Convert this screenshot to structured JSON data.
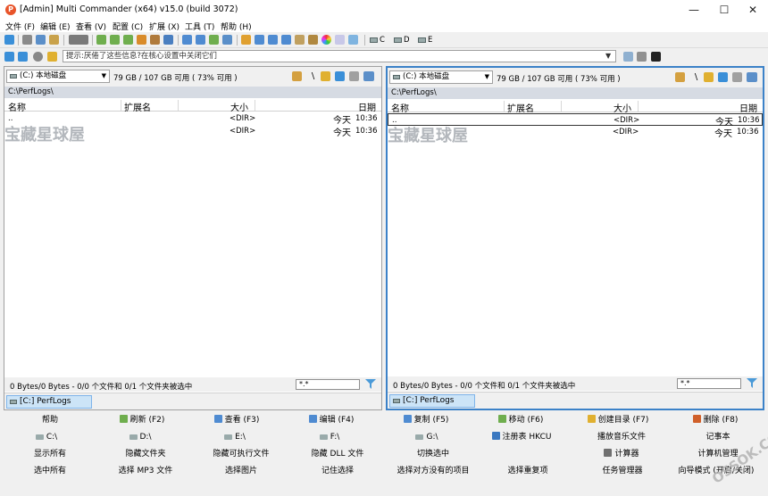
{
  "window": {
    "title": "[Admin] Multi Commander (x64)  v15.0 (build 3072)",
    "app_icon_letter": "P",
    "controls": {
      "minimize": "—",
      "maximize": "☐",
      "close": "✕"
    }
  },
  "menu": [
    {
      "label": "文件 (F)"
    },
    {
      "label": "编辑 (E)"
    },
    {
      "label": "查看 (V)"
    },
    {
      "label": "配置 (C)"
    },
    {
      "label": "扩展 (X)"
    },
    {
      "label": "工具 (T)"
    },
    {
      "label": "帮助 (H)"
    }
  ],
  "toolbar": {
    "drives": [
      "C",
      "D",
      "E"
    ]
  },
  "command_line": {
    "value": "提示:厌倦了这些信息?在核心设置中关闭它们"
  },
  "left_panel": {
    "drive": "(C:) 本地磁盘",
    "space": "79 GB / 107 GB 可用 ( 73% 可用 )",
    "path": "C:\\PerfLogs\\",
    "columns": {
      "name": "名称",
      "ext": "扩展名",
      "size": "大小",
      "date": "日期"
    },
    "rows": [
      {
        "name": "..",
        "size": "<DIR>",
        "date": "今天",
        "time": "10:36"
      },
      {
        "name": "",
        "size": "<DIR>",
        "date": "今天",
        "time": "10:36"
      }
    ],
    "watermark": "宝藏星球屋",
    "status": "0 Bytes/0 Bytes - 0/0 个文件和 0/1 个文件夹被选中",
    "filter": "*.*",
    "tab": "[C:] PerfLogs"
  },
  "right_panel": {
    "drive": "(C:) 本地磁盘",
    "space": "79 GB / 107 GB 可用 ( 73% 可用 )",
    "path": "C:\\PerfLogs\\",
    "columns": {
      "name": "名称",
      "ext": "扩展名",
      "size": "大小",
      "date": "日期"
    },
    "rows": [
      {
        "name": "..",
        "size": "<DIR>",
        "date": "今天",
        "time": "10:36"
      },
      {
        "name": "",
        "size": "<DIR>",
        "date": "今天",
        "time": "10:36"
      }
    ],
    "watermark": "宝藏星球屋",
    "status": "0 Bytes/0 Bytes - 0/0 个文件和 0/1 个文件夹被选中",
    "filter": "*.*",
    "tab": "[C:] PerfLogs"
  },
  "buttons": {
    "row1": [
      "帮助",
      "刷新 (F2)",
      "查看 (F3)",
      "编辑 (F4)",
      "复制 (F5)",
      "移动 (F6)",
      "创建目录 (F7)",
      "删除 (F8)"
    ],
    "row2": [
      "C:\\",
      "D:\\",
      "E:\\",
      "F:\\",
      "G:\\",
      "注册表 HKCU",
      "播放音乐文件",
      "记事本"
    ],
    "row3": [
      "显示所有",
      "隐藏文件夹",
      "隐藏可执行文件",
      "隐藏 DLL 文件",
      "切换选中",
      "",
      "计算器",
      "计算机管理"
    ],
    "row4": [
      "选中所有",
      "选择 MP3 文件",
      "选择图片",
      "记住选择",
      "选择对方没有的项目",
      "选择重复项",
      "任务管理器",
      "向导模式 (开启/关闭)"
    ]
  },
  "corner_watermark": "OSSOK.COM"
}
